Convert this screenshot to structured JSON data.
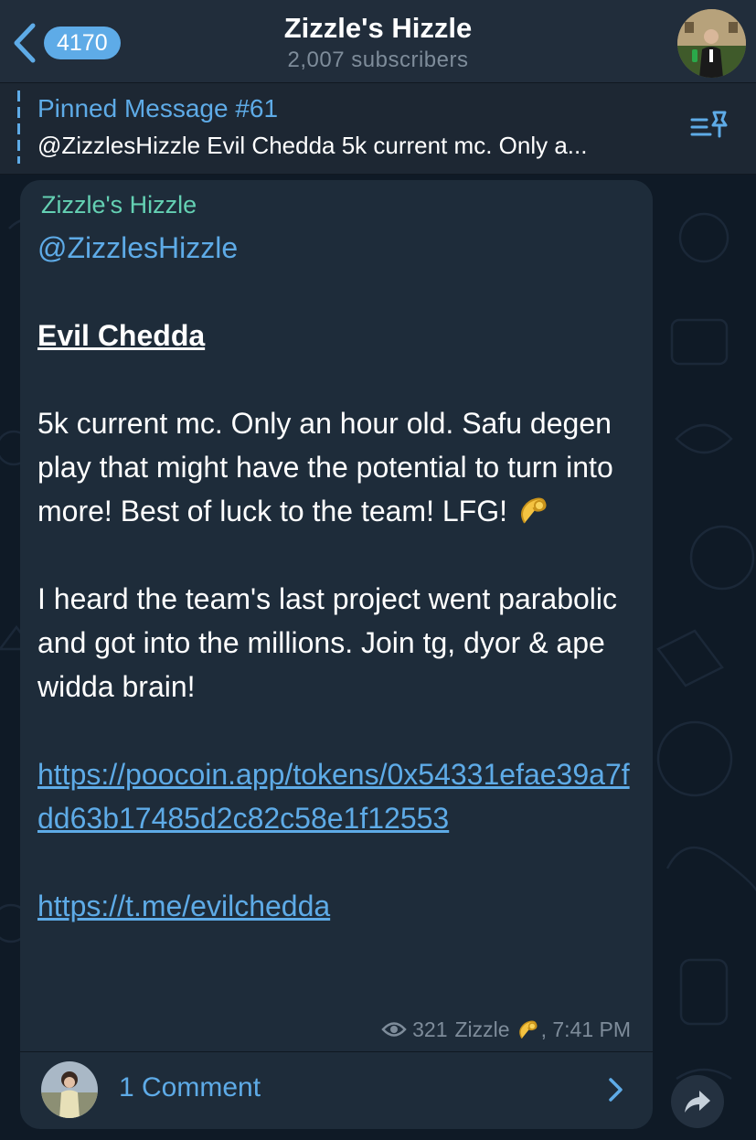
{
  "header": {
    "back_badge": "4170",
    "title": "Zizzle's Hizzle",
    "subtitle": "2,007 subscribers",
    "avatar_caption": "Zizzle's Hizzle"
  },
  "pinned": {
    "title": "Pinned Message #61",
    "text": "@ZizzlesHizzle Evil Chedda 5k current mc.  Only a..."
  },
  "message": {
    "sender": "Zizzle's Hizzle",
    "mention": "@ZizzlesHizzle",
    "heading": "Evil Chedda",
    "paragraph1": "5k current mc.  Only an hour old.  Safu degen play that might have the potential to turn into more!  Best of luck to the team!  LFG!",
    "paragraph2": "I heard the team's last project went parabolic and got into the millions. Join tg, dyor & ape widda brain!",
    "link1": "https://poocoin.app/tokens/0x54331efae39a7fdd63b17485d2c82c58e1f12553",
    "link2": "https://t.me/evilchedda",
    "views": "321",
    "signature": "Zizzle",
    "time": ", 7:41 PM"
  },
  "comments": {
    "label": "1 Comment"
  },
  "colors": {
    "accent": "#5eabe7",
    "sender": "#64d0b3",
    "header_bg": "#212d3b",
    "bubble_bg": "#1e2c3a",
    "chat_bg": "#0f1a26"
  },
  "icons": {
    "back": "chevron-left-icon",
    "pin_list": "pinned-list-icon",
    "views": "eye-icon",
    "emoji": "pinching-hand-emoji",
    "comments_arrow": "chevron-right-icon",
    "share": "share-arrow-icon"
  }
}
